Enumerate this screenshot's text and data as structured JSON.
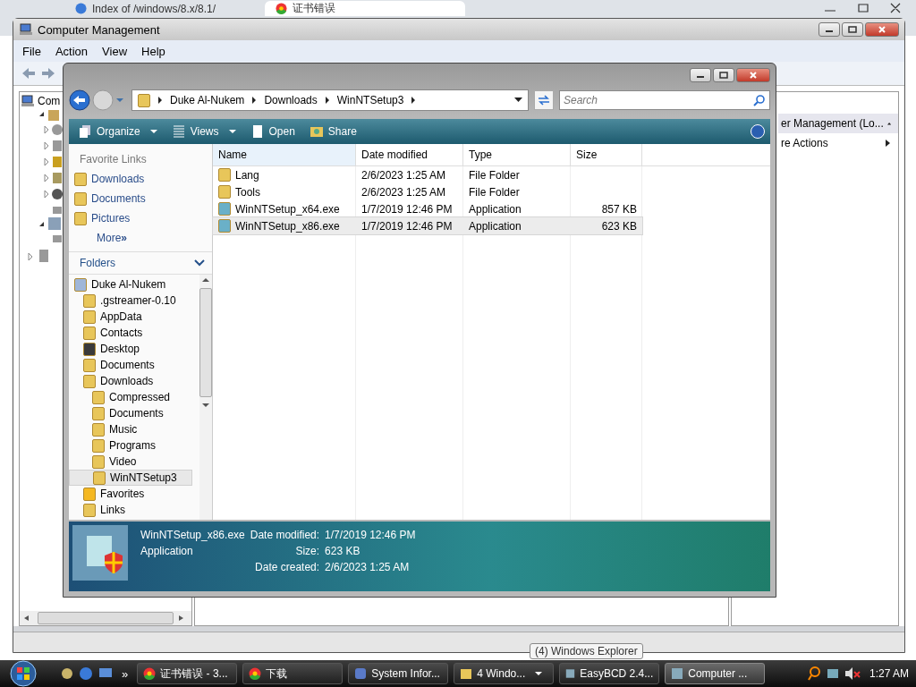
{
  "browser": {
    "tabs": [
      {
        "title": "Index of /windows/8.x/8.1/",
        "selected": false
      },
      {
        "title": "证书错误",
        "selected": true
      }
    ]
  },
  "cm": {
    "title": "Computer Management",
    "menu": [
      "File",
      "Action",
      "View",
      "Help"
    ],
    "tree_root": "Com",
    "actions": [
      {
        "label": "er Management (Lo...",
        "kind": "header"
      },
      {
        "label": "re Actions",
        "kind": "item"
      }
    ]
  },
  "explorer": {
    "breadcrumb": [
      "Duke Al-Nukem",
      "Downloads",
      "WinNTSetup3"
    ],
    "search": {
      "placeholder": "Search"
    },
    "toolbar": [
      {
        "label": "Organize",
        "kind": "menu"
      },
      {
        "label": "Views",
        "kind": "menu"
      },
      {
        "label": "Open",
        "kind": "button"
      },
      {
        "label": "Share",
        "kind": "button"
      }
    ],
    "favorites": {
      "title": "Favorite Links",
      "items": [
        "Downloads",
        "Documents",
        "Pictures"
      ],
      "more": "More",
      "more_mark": "»"
    },
    "folders": {
      "title": "Folders",
      "tree": [
        {
          "label": "Duke Al-Nukem",
          "kind": "user",
          "selected": false,
          "children": [
            {
              "label": ".gstreamer-0.10",
              "kind": "folder",
              "selected": false
            },
            {
              "label": "AppData",
              "kind": "folder",
              "selected": false
            },
            {
              "label": "Contacts",
              "kind": "folder",
              "selected": false
            },
            {
              "label": "Desktop",
              "kind": "desktop",
              "selected": false
            },
            {
              "label": "Documents",
              "kind": "folder",
              "selected": false
            },
            {
              "label": "Downloads",
              "kind": "folder",
              "selected": false,
              "children": [
                {
                  "label": "Compressed",
                  "kind": "folder",
                  "selected": false
                },
                {
                  "label": "Documents",
                  "kind": "folder",
                  "selected": false
                },
                {
                  "label": "Music",
                  "kind": "folder",
                  "selected": false
                },
                {
                  "label": "Programs",
                  "kind": "folder",
                  "selected": false
                },
                {
                  "label": "Video",
                  "kind": "folder",
                  "selected": false
                },
                {
                  "label": "WinNTSetup3",
                  "kind": "folder",
                  "selected": true
                }
              ]
            },
            {
              "label": "Favorites",
              "kind": "star",
              "selected": false
            },
            {
              "label": "Links",
              "kind": "folder",
              "selected": false
            }
          ]
        }
      ]
    },
    "columns": [
      "Name",
      "Date modified",
      "Type",
      "Size"
    ],
    "rows": [
      {
        "name": "Lang",
        "date": "2/6/2023 1:25 AM",
        "type": "File Folder",
        "size": "",
        "kind": "folder",
        "selected": false
      },
      {
        "name": "Tools",
        "date": "2/6/2023 1:25 AM",
        "type": "File Folder",
        "size": "",
        "kind": "folder",
        "selected": false
      },
      {
        "name": "WinNTSetup_x64.exe",
        "date": "1/7/2019 12:46 PM",
        "type": "Application",
        "size": "857 KB",
        "kind": "app",
        "selected": false
      },
      {
        "name": "WinNTSetup_x86.exe",
        "date": "1/7/2019 12:46 PM",
        "type": "Application",
        "size": "623 KB",
        "kind": "app",
        "selected": true
      }
    ],
    "details": {
      "name": "WinNTSetup_x86.exe",
      "type": "Application",
      "fields": [
        {
          "label": "Date modified:",
          "value": "1/7/2019 12:46 PM"
        },
        {
          "label": "Size:",
          "value": "623 KB"
        },
        {
          "label": "Date created:",
          "value": "2/6/2023 1:25 AM"
        }
      ]
    }
  },
  "taskbar": {
    "overflow": "»",
    "items": [
      {
        "label": "证书错误 - 3...",
        "selected": false
      },
      {
        "label": "下载",
        "selected": false
      },
      {
        "label": "System Infor...",
        "selected": false
      },
      {
        "label": "4 Windo...",
        "selected": false
      },
      {
        "label": "EasyBCD 2.4...",
        "selected": false
      },
      {
        "label": "Computer ...",
        "selected": true
      }
    ],
    "clock": "1:27 AM",
    "tooltip": "(4) Windows Explorer"
  }
}
